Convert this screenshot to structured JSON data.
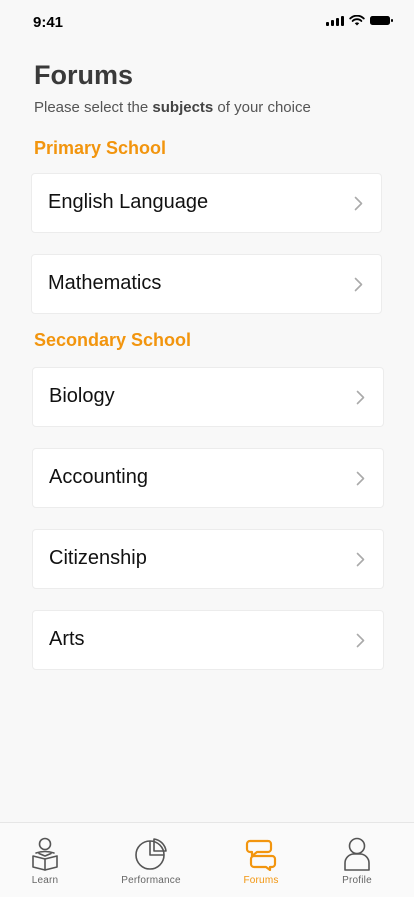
{
  "status_bar": {
    "time": "9:41"
  },
  "header": {
    "title": "Forums",
    "subtitle_before": "Please select the ",
    "subtitle_bold": "subjects",
    "subtitle_after": " of your choice"
  },
  "sections": [
    {
      "title": "Primary School",
      "items": [
        {
          "label": "English Language"
        },
        {
          "label": "Mathematics"
        }
      ]
    },
    {
      "title": "Secondary School",
      "items": [
        {
          "label": "Biology"
        },
        {
          "label": "Accounting"
        },
        {
          "label": "Citizenship"
        },
        {
          "label": "Arts"
        }
      ]
    }
  ],
  "tab_bar": {
    "active_color": "#f2950e",
    "tabs": [
      {
        "label": "Learn",
        "icon": "reader-icon"
      },
      {
        "label": "Performance",
        "icon": "pie-chart-icon"
      },
      {
        "label": "Forums",
        "icon": "chat-bubbles-icon",
        "active": true
      },
      {
        "label": "Profile",
        "icon": "user-icon"
      }
    ]
  }
}
